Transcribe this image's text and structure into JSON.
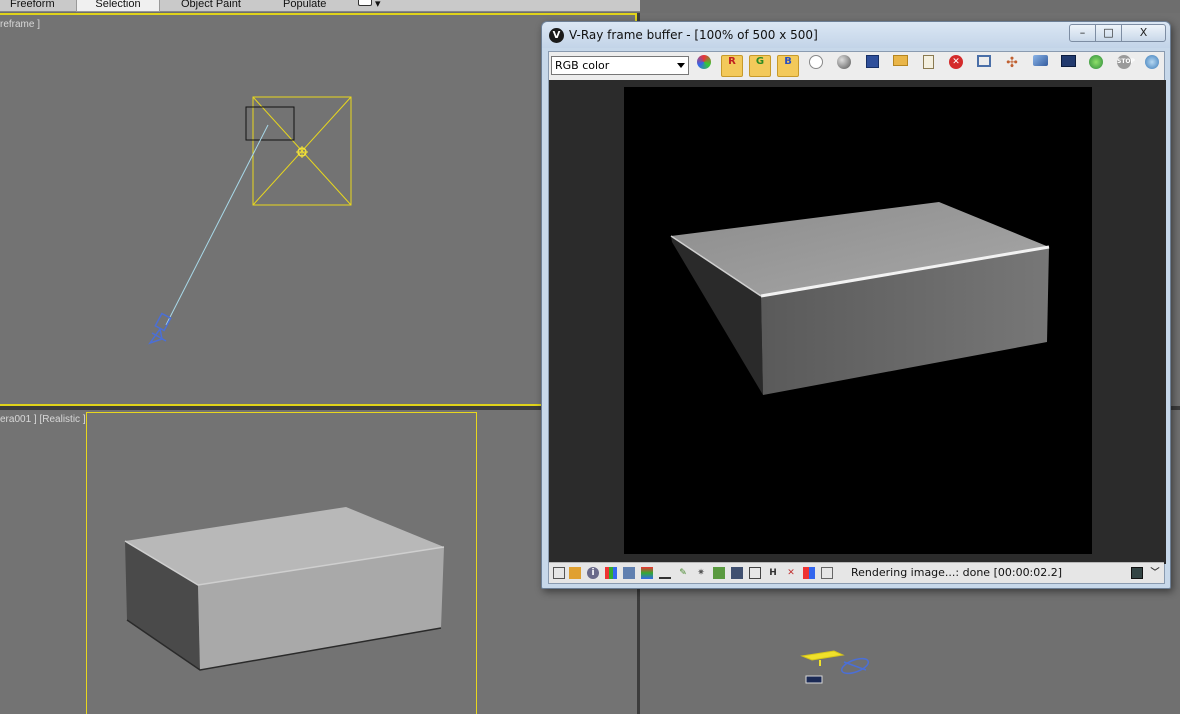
{
  "ribbon": {
    "tabs": [
      "Freeform",
      "Selection",
      "Object Paint",
      "Populate"
    ],
    "active_tab": "Selection"
  },
  "viewports": {
    "top_label": "reframe ]",
    "camera_label": "era001 ] [Realistic ]"
  },
  "vfb": {
    "title": "V-Ray frame buffer - [100% of 500 x 500]",
    "logo": "V",
    "window_buttons": {
      "minimize": "–",
      "maximize": "□",
      "close": "X"
    },
    "channel": "RGB color",
    "channel_buttons": {
      "red": "R",
      "green": "G",
      "blue": "B"
    },
    "status": "Rendering image...: done [00:00:02.2]",
    "status_letter": "H"
  },
  "colors": {
    "selection_yellow": "#e0d31a",
    "viewport_gray": "#737373",
    "render_bg": "#000000"
  }
}
